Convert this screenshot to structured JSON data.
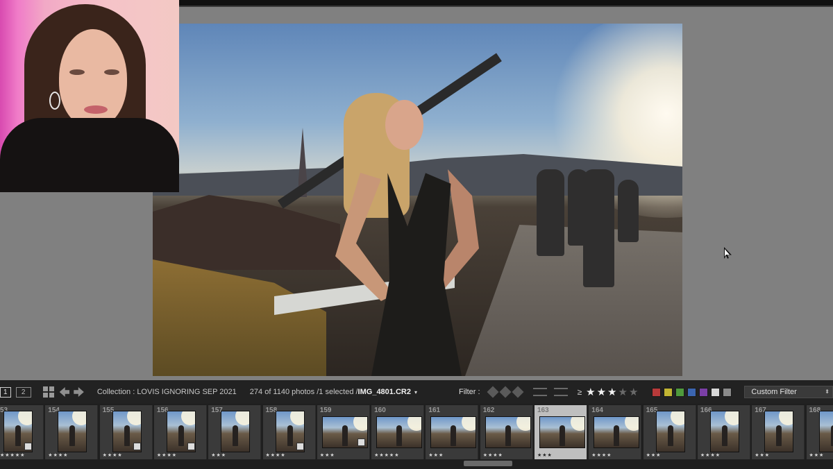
{
  "screen_buttons": [
    "1",
    "2"
  ],
  "status": {
    "collection": "Collection : LOVIS IGNORING SEP 2021",
    "count": "274 of 1140 photos /1 selected /",
    "filename": "IMG_4801.CR2",
    "caret": "▾"
  },
  "filter": {
    "label": "Filter :",
    "ge": "≥",
    "stars_on": "★★★",
    "stars_off": "★★",
    "rating_min": 3,
    "preset": "Custom Filter",
    "preset_caret": "⬍",
    "colors": [
      "#b83a3a",
      "#c2b533",
      "#4f9a3c",
      "#3b65b0",
      "#7b3fa6",
      "#d8d8d8",
      "#8a8a8a"
    ]
  },
  "filmstrip": {
    "cells": [
      {
        "num": "53",
        "rating": "★★★★★",
        "shape": "portrait",
        "badge": true
      },
      {
        "num": "154",
        "rating": "★★★★",
        "shape": "portrait",
        "badge": false
      },
      {
        "num": "155",
        "rating": "★★★★",
        "shape": "portrait",
        "badge": true
      },
      {
        "num": "156",
        "rating": "★★★★",
        "shape": "portrait",
        "badge": true
      },
      {
        "num": "157",
        "rating": "★★★",
        "shape": "portrait",
        "badge": false
      },
      {
        "num": "158",
        "rating": "★★★★",
        "shape": "portrait",
        "badge": true
      },
      {
        "num": "159",
        "rating": "★★★",
        "shape": "landscape",
        "badge": true
      },
      {
        "num": "160",
        "rating": "★★★★★",
        "shape": "landscape",
        "badge": false
      },
      {
        "num": "161",
        "rating": "★★★",
        "shape": "landscape",
        "badge": false
      },
      {
        "num": "162",
        "rating": "★★★★",
        "shape": "landscape",
        "badge": false
      },
      {
        "num": "163",
        "rating": "★★★",
        "shape": "landscape",
        "badge": false,
        "selected": true
      },
      {
        "num": "164",
        "rating": "★★★★",
        "shape": "landscape",
        "badge": false
      },
      {
        "num": "165",
        "rating": "★★★",
        "shape": "portrait",
        "badge": false
      },
      {
        "num": "166",
        "rating": "★★★★",
        "shape": "portrait",
        "badge": false
      },
      {
        "num": "167",
        "rating": "★★★",
        "shape": "portrait",
        "badge": false
      },
      {
        "num": "168",
        "rating": "★★★",
        "shape": "portrait",
        "badge": false
      }
    ]
  }
}
